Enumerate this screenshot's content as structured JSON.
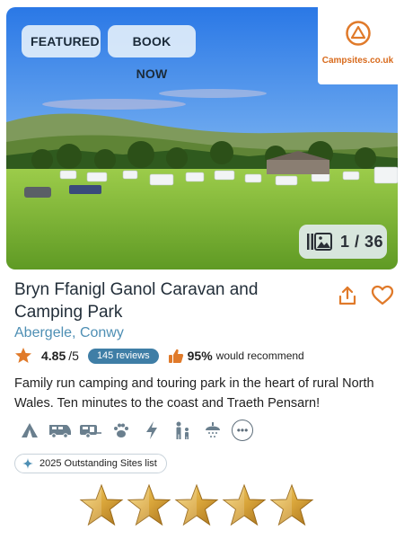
{
  "hero": {
    "badges": {
      "featured": "FEATURED",
      "book_now": "BOOK NOW"
    },
    "brand": {
      "name": "Campsites.co.uk"
    },
    "photo_counter": "1 / 36"
  },
  "listing": {
    "title": "Bryn Ffanigl Ganol Caravan and Camping Park",
    "location": "Abergele, Conwy",
    "rating": {
      "value": "4.85",
      "max": "/5",
      "reviews": "145 reviews"
    },
    "recommend": {
      "percent": "95%",
      "text": "would recommend"
    },
    "description": "Family run camping and touring park in the heart of rural North Wales. Ten minutes to the coast and Traeth Pensarn!",
    "amenities": [
      "tent-icon",
      "motorhome-icon",
      "caravan-icon",
      "pet-icon",
      "electric-icon",
      "family-icon",
      "toilet-block-icon"
    ],
    "more_label": "•••",
    "award": "2025 Outstanding Sites list",
    "star_rating": 5
  },
  "colors": {
    "brand_orange": "#e07a2a",
    "link_blue": "#4e8fb4",
    "pill_blue": "#3f7ea6",
    "icon_gray": "#6a7f8e"
  }
}
